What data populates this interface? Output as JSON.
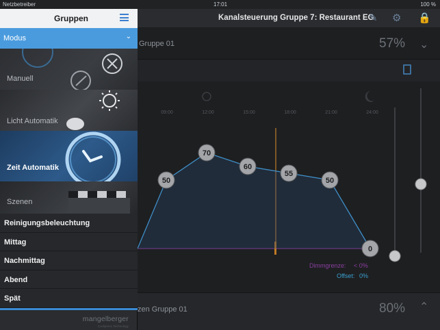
{
  "status_bar": {
    "carrier": "Netzbetreiber",
    "time": "17:01",
    "battery": "100 %"
  },
  "header": {
    "title": "Kanalsteuerung Gruppe 7: Restaurant EG"
  },
  "group1": {
    "name": "Gruppe 01",
    "percent": "57%"
  },
  "group2": {
    "name": "zen Gruppe 01",
    "percent": "80%"
  },
  "sidebar": {
    "title": "Gruppen",
    "modus_label": "Modus",
    "modes": [
      {
        "label": "Manuell"
      },
      {
        "label": "Licht Automatik"
      },
      {
        "label": "Zeit Automatik"
      },
      {
        "label": "Szenen"
      }
    ],
    "programs": [
      {
        "label": "Reinigungsbeleuchtung"
      },
      {
        "label": "Mittag"
      },
      {
        "label": "Nachmittag"
      },
      {
        "label": "Abend"
      },
      {
        "label": "Spät"
      }
    ],
    "logo": "mangelberger",
    "logo_sub": "Cockpress Technology"
  },
  "chart_data": {
    "type": "line",
    "time_ticks": [
      "09:00",
      "12:00",
      "15:00",
      "18:00",
      "21:00",
      "24:00"
    ],
    "points": [
      50,
      70,
      60,
      55,
      50,
      0
    ],
    "point_labels": [
      "50",
      "70",
      "60",
      "55",
      "50",
      "0"
    ],
    "dimm_label": "Dimmgrenze:",
    "dimm_value": "< 0%",
    "offset_label": "Offset:",
    "offset_value": "0%"
  },
  "colors": {
    "accent": "#4a9bde",
    "curve": "#3f8fc8",
    "dimm": "#8a3fa0",
    "offset": "#3aa0cf",
    "now_line": "#e0902a"
  }
}
